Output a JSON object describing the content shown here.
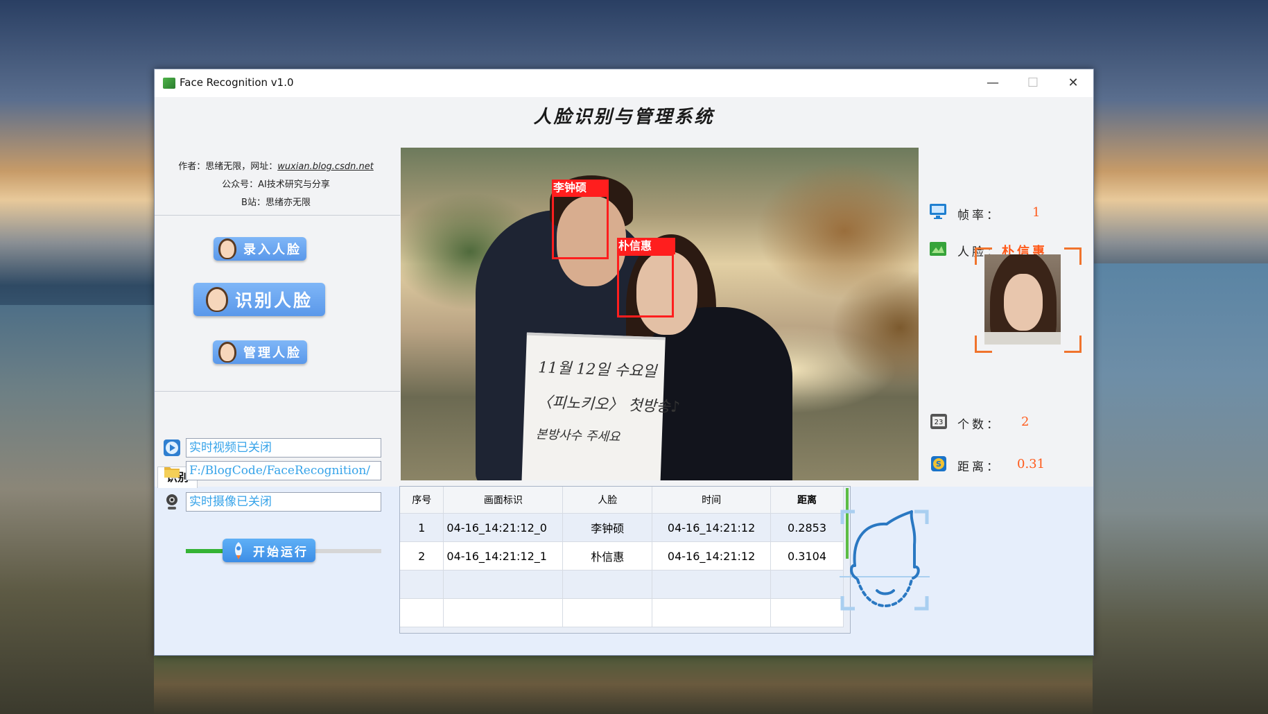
{
  "window": {
    "title": "Face Recognition v1.0",
    "controls": {
      "minimize": "—",
      "maximize": "☐",
      "close": "✕"
    }
  },
  "app_title": "人脸识别与管理系统",
  "info": {
    "author_prefix": "作者：思绪无限，网址：",
    "author_url": "wuxian.blog.csdn.net",
    "wechat": "公众号：AI技术研究与分享",
    "bilibili": "B站：思绪亦无限"
  },
  "buttons": {
    "enroll": "录入人脸",
    "recognize": "识别人脸",
    "manage": "管理人脸",
    "start": "开始运行"
  },
  "tab": {
    "label": "识别"
  },
  "status": {
    "video": "实时视频已关闭",
    "file_path": "F:/BlogCode/FaceRecognition/",
    "camera": "实时摄像已关闭",
    "progress": 0.44
  },
  "detections": [
    {
      "name": "李钟硕"
    },
    {
      "name": "朴信惠"
    }
  ],
  "sign_text": [
    "11월 12일 수요일",
    "〈피노키오〉 첫방송♪",
    "본방사수 주세요"
  ],
  "stats": {
    "fps_label": "帧率：",
    "fps_value": "1",
    "face_label": "人脸：",
    "face_value": "朴信惠",
    "count_label": "个数：",
    "count_value": "2",
    "distance_label": "距离：",
    "distance_value": "0.31"
  },
  "table": {
    "headers": [
      "序号",
      "画面标识",
      "人脸",
      "时间",
      "距离"
    ],
    "rows": [
      [
        "1",
        "04-16_14:21:12_0",
        "李钟硕",
        "04-16_14:21:12",
        "0.2853"
      ],
      [
        "2",
        "04-16_14:21:12_1",
        "朴信惠",
        "04-16_14:21:12",
        "0.3104"
      ],
      [
        "",
        "",
        "",
        "",
        ""
      ],
      [
        "",
        "",
        "",
        "",
        ""
      ]
    ]
  },
  "icons": {
    "fps": "monitor-icon",
    "face": "face-card-icon",
    "count": "counter-icon",
    "distance": "distance-icon",
    "video": "play-icon",
    "file": "folder-icon",
    "camera": "webcam-icon"
  },
  "colors": {
    "accent_orange": "#ff5a1a",
    "button_blue": "#5a98ea",
    "detection_red": "#ff1e1e",
    "field_text": "#36a3e9"
  }
}
